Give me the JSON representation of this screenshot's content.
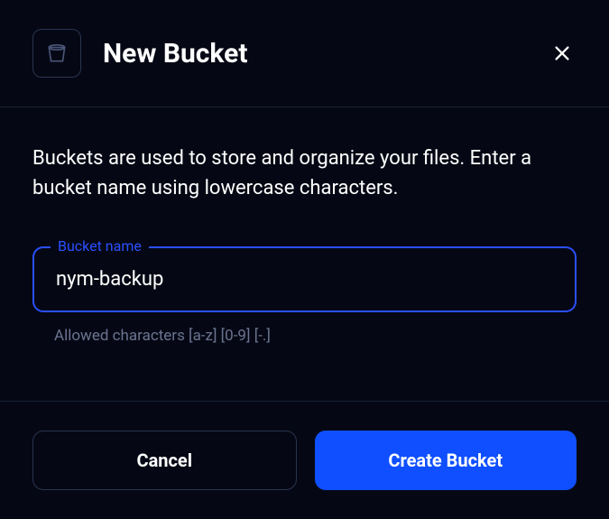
{
  "dialog": {
    "title": "New Bucket",
    "description": "Buckets are used to store and organize your files. Enter a bucket name using lowercase characters.",
    "input": {
      "label": "Bucket name",
      "value": "nym-backup",
      "help": "Allowed characters [a-z] [0-9] [-.]"
    },
    "buttons": {
      "cancel": "Cancel",
      "submit": "Create Bucket"
    }
  }
}
